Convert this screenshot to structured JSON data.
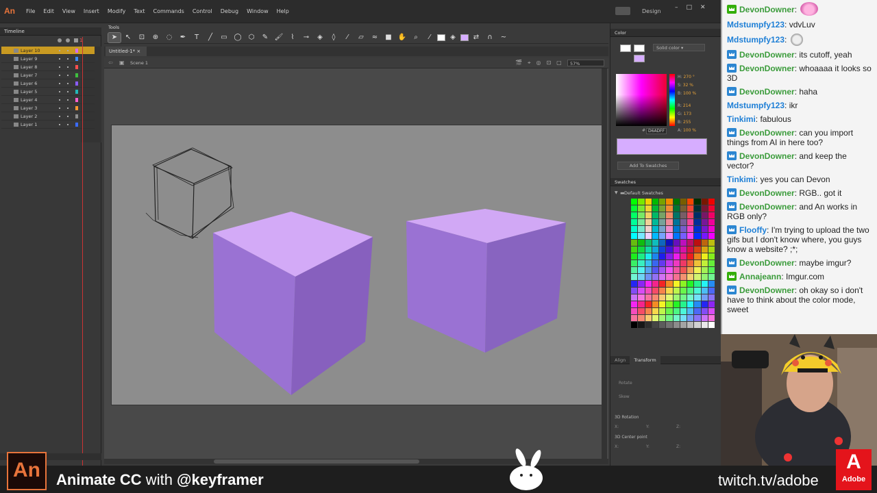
{
  "app": {
    "logo": "An",
    "menu": [
      "File",
      "Edit",
      "View",
      "Insert",
      "Modify",
      "Text",
      "Commands",
      "Control",
      "Debug",
      "Window",
      "Help"
    ],
    "workspace": "Design"
  },
  "timeline": {
    "title": "Timeline",
    "playhead_frame": "1",
    "layers": [
      {
        "name": "Layer 10",
        "color": "#d46bff",
        "selected": true
      },
      {
        "name": "Layer 9",
        "color": "#3b8cff"
      },
      {
        "name": "Layer 8",
        "color": "#ff4f4f"
      },
      {
        "name": "Layer 7",
        "color": "#3fbf3f"
      },
      {
        "name": "Layer 6",
        "color": "#8a5cff"
      },
      {
        "name": "Layer 5",
        "color": "#22b8b8"
      },
      {
        "name": "Layer 4",
        "color": "#ff5fd2"
      },
      {
        "name": "Layer 3",
        "color": "#ff9a2e"
      },
      {
        "name": "Layer 2",
        "color": "#8f8f8f"
      },
      {
        "name": "Layer 1",
        "color": "#3b6cff"
      }
    ]
  },
  "tools": {
    "title": "Tools"
  },
  "document": {
    "tab": "Untitled-1*",
    "scene": "Scene 1",
    "zoom": "57%"
  },
  "color_panel": {
    "title": "Color",
    "fill_type": "Solid color",
    "hsb": {
      "H": "270 °",
      "S": "32 %",
      "B": "100 %"
    },
    "rgb": {
      "R": "214",
      "G": "173",
      "B": "255"
    },
    "alpha": "100 %",
    "hex": "D6ADFF",
    "add_button": "Add To Swatches",
    "fill_color": "#d6adff"
  },
  "swatches_panel": {
    "title": "Swatches",
    "group": "Default Swatches"
  },
  "transform_panel": {
    "tabs": [
      "Align",
      "Transform"
    ],
    "rotate": "Rotate",
    "skew": "Skew",
    "rotation_3d": "3D Rotation",
    "center_3d": "3D Center point",
    "x": "X:",
    "y": "Y:",
    "z": "Z:",
    "zero": "0.0 °"
  },
  "chat": [
    {
      "user": "DevonDowner",
      "color": "#3a9b3a",
      "badge": "mod",
      "text": ": ",
      "emote": "heart"
    },
    {
      "user": "Mdstumpfy123",
      "color": "#1e7fd6",
      "badge": "",
      "text": ": vdvLuv"
    },
    {
      "user": "Mdstumpfy123",
      "color": "#1e7fd6",
      "badge": "",
      "text": ": ",
      "emote": "face"
    },
    {
      "user": "DevonDowner",
      "color": "#3a9b3a",
      "badge": "sub",
      "text": ": its cutoff, yeah"
    },
    {
      "user": "DevonDowner",
      "color": "#3a9b3a",
      "badge": "sub",
      "text": ": whoaaaa it looks so 3D"
    },
    {
      "user": "DevonDowner",
      "color": "#3a9b3a",
      "badge": "sub",
      "text": ": haha"
    },
    {
      "user": "Mdstumpfy123",
      "color": "#1e7fd6",
      "badge": "",
      "text": ": ikr"
    },
    {
      "user": "Tinkimi",
      "color": "#1e7fd6",
      "badge": "",
      "text": ": fabulous"
    },
    {
      "user": "DevonDowner",
      "color": "#3a9b3a",
      "badge": "sub",
      "text": ": can you import things from AI in here too?"
    },
    {
      "user": "DevonDowner",
      "color": "#3a9b3a",
      "badge": "sub",
      "text": ": and keep the vector?"
    },
    {
      "user": "Tinkimi",
      "color": "#1e7fd6",
      "badge": "",
      "text": ": yes you can Devon"
    },
    {
      "user": "DevonDowner",
      "color": "#3a9b3a",
      "badge": "sub",
      "text": ": RGB.. got it"
    },
    {
      "user": "DevonDowner",
      "color": "#3a9b3a",
      "badge": "sub",
      "text": ": and An works in RGB only?"
    },
    {
      "user": "Flooffy",
      "color": "#1e7fd6",
      "badge": "sub",
      "text": ": I'm trying to upload the two gifs but I don't know where, you guys know a website? ;*;"
    },
    {
      "user": "DevonDowner",
      "color": "#3a9b3a",
      "badge": "sub",
      "text": ": maybe imgur?"
    },
    {
      "user": "Annajeann",
      "color": "#3a9b3a",
      "badge": "mod",
      "text": ": Imgur.com"
    },
    {
      "user": "DevonDowner",
      "color": "#3a9b3a",
      "badge": "sub",
      "text": ": oh okay so i don't have to think about the color mode, sweet"
    }
  ],
  "overlay": {
    "an_logo": "An",
    "title_bold": "Animate CC",
    "title_with": " with ",
    "title_handle": "@keyframer",
    "url": "twitch.tv/adobe",
    "adobe": "Adobe",
    "adobe_mark": "A"
  }
}
